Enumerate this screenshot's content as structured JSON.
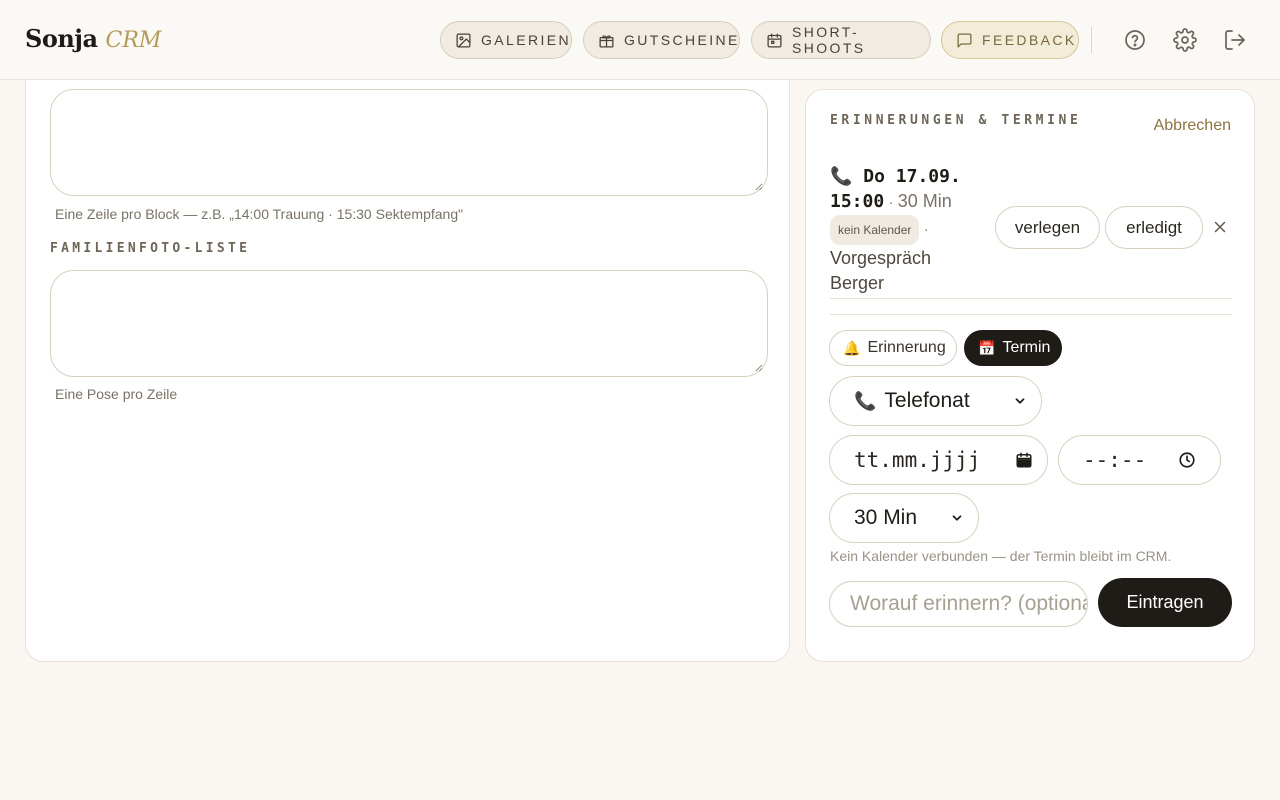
{
  "brand": {
    "name": "Sonja",
    "sub": "CRM"
  },
  "nav": [
    {
      "label": "GALERIEN",
      "icon": "image-icon"
    },
    {
      "label": "GUTSCHEINE",
      "icon": "gift-icon"
    },
    {
      "label": "SHORT-SHOOTS",
      "icon": "calendar-icon"
    },
    {
      "label": "FEEDBACK",
      "icon": "message-icon"
    }
  ],
  "header_icons": [
    "help-icon",
    "settings-icon",
    "logout-icon"
  ],
  "left": {
    "schedule_hint": "Eine Zeile pro Block — z.B. „14:00 Trauung · 15:30 Sektempfang\"",
    "family_label": "FAMILIENFOTO-LISTE",
    "family_hint": "Eine Pose pro Zeile"
  },
  "reminders": {
    "title": "ERINNERUNGEN & TERMINE",
    "cancel": "Abbrechen",
    "appointment": {
      "icon": "📞",
      "date": "Do 17.09.",
      "time": "15:00",
      "separator": "·",
      "duration": "30 Min",
      "badge": "kein Kalender",
      "name": "Vorgespräch Berger"
    },
    "actions": {
      "reschedule": "verlegen",
      "done": "erledigt"
    },
    "tabs": [
      {
        "icon": "🔔",
        "label": "Erinnerung",
        "active": false
      },
      {
        "icon": "📅",
        "label": "Termin",
        "active": true
      }
    ],
    "type_select": {
      "icon": "📞",
      "value": "Telefonat"
    },
    "date_placeholder": "tt.mm.jjjj",
    "time_placeholder": "--:--",
    "duration_select": "30 Min",
    "note": "Kein Kalender verbunden — der Termin bleibt im CRM.",
    "input_placeholder": "Worauf erinnern? (optional)",
    "submit": "Eintragen"
  },
  "colors": {
    "accent": "#b59a5a",
    "dark": "#1f1b16",
    "background": "#faf7f2"
  }
}
